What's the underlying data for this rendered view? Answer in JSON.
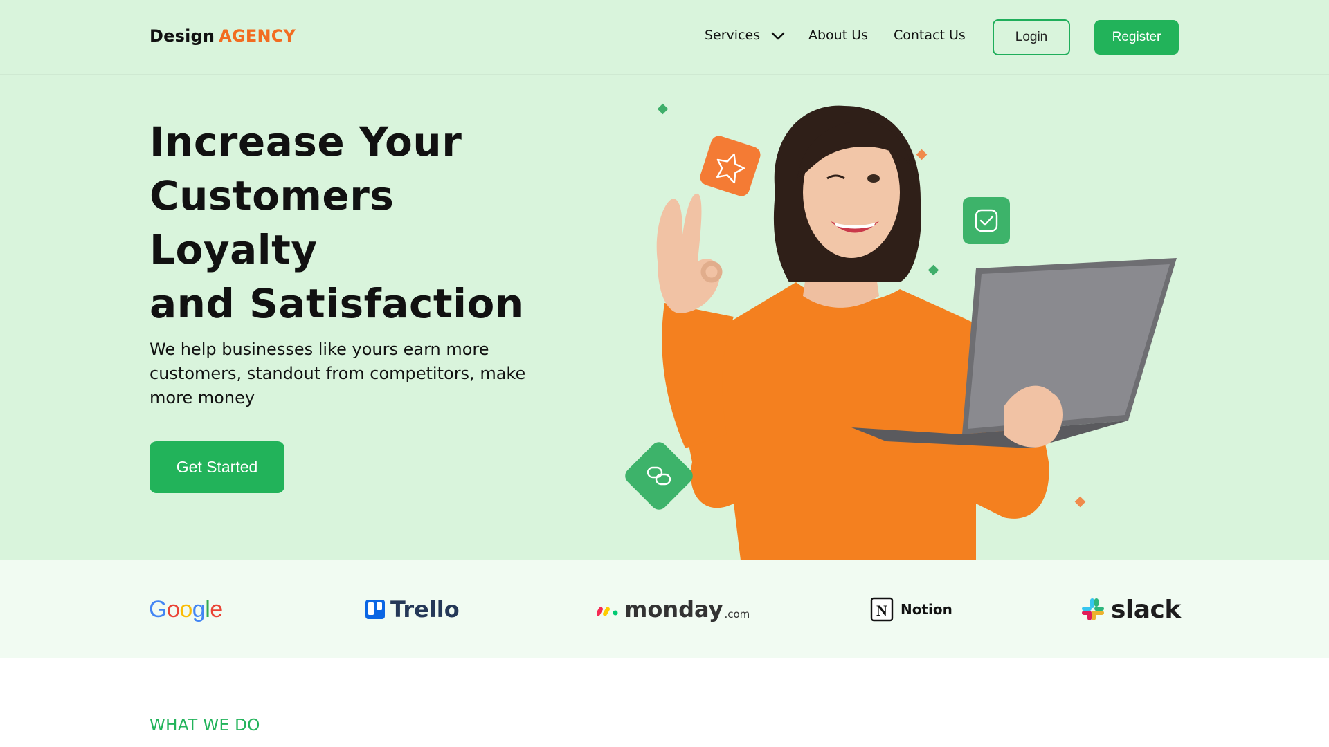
{
  "header": {
    "logo_part1": "Design",
    "logo_part2": "AGENCY",
    "nav": {
      "services": "Services",
      "about": "About Us",
      "contact": "Contact Us"
    },
    "login_label": "Login",
    "register_label": "Register"
  },
  "hero": {
    "title_lines": [
      "Increase Your",
      "Customers",
      "Loyalty",
      "and Satisfaction"
    ],
    "subtitle": "We help businesses like yours earn more customers, standout from competitors, make more money",
    "cta_label": "Get Started"
  },
  "partners": {
    "google": "Google",
    "trello": "Trello",
    "monday": "monday",
    "monday_suffix": ".com",
    "notion": "Notion",
    "slack": "slack"
  },
  "section": {
    "label": "WHAT WE DO"
  },
  "colors": {
    "brand_green": "#22b35a",
    "accent_orange": "#f26c20",
    "hero_bg": "#d9f4dc",
    "logos_bg": "#f1fbf2"
  },
  "icons": [
    "chevron-down-icon",
    "star-badge-icon",
    "check-badge-icon",
    "link-badge-icon",
    "trello-icon",
    "monday-icon",
    "notion-icon",
    "slack-icon"
  ]
}
